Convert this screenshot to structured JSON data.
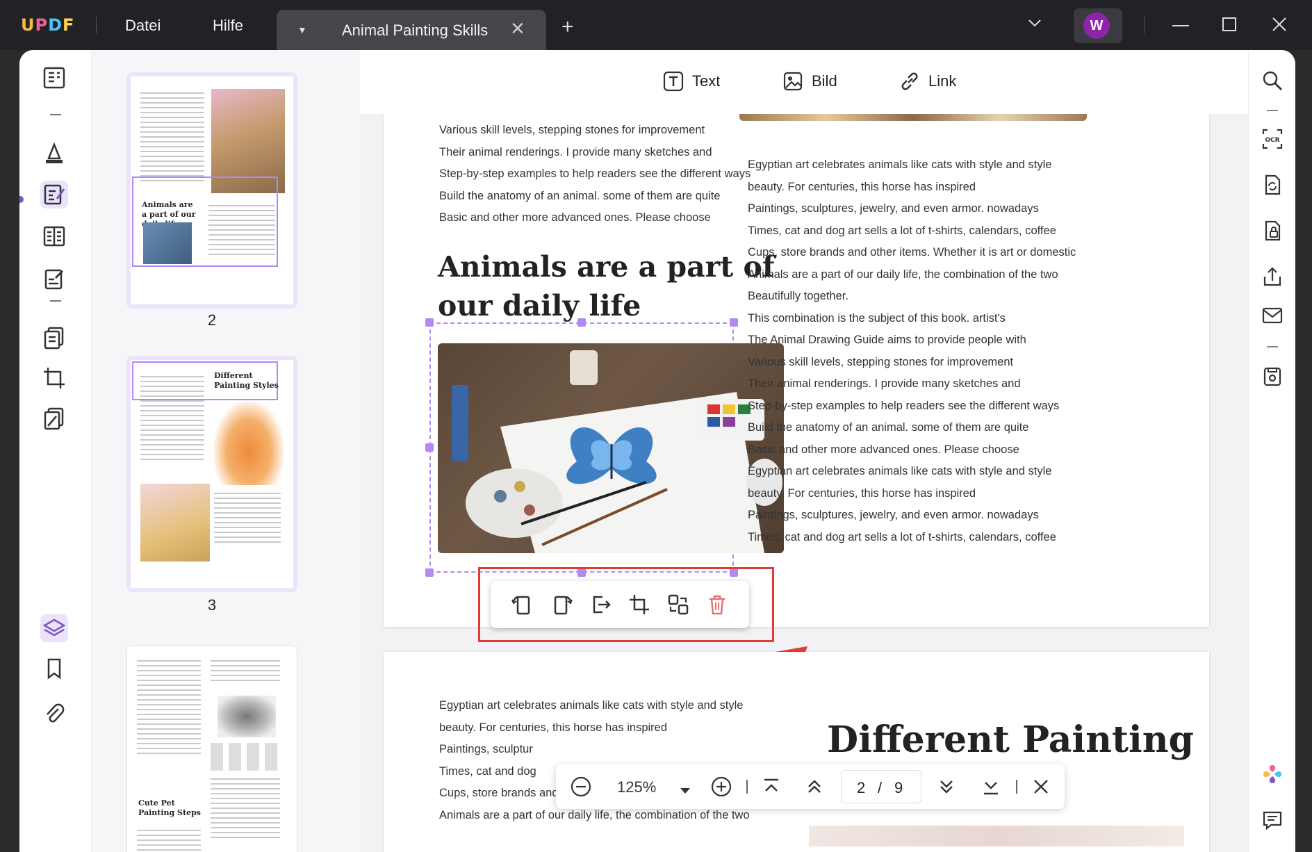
{
  "app": {
    "logo": "UPDF",
    "menu": [
      "Datei",
      "Hilfe"
    ],
    "tab_title": "Animal Painting Skills",
    "avatar_initial": "W"
  },
  "edit_toolbar": {
    "text_label": "Text",
    "image_label": "Bild",
    "link_label": "Link"
  },
  "thumbnails": [
    {
      "page_number": "2",
      "heading": "Animals are a part of our daily life"
    },
    {
      "page_number": "3",
      "heading": "Different Painting Styles"
    },
    {
      "page_number": "",
      "heading": "Cute Pet Painting Steps"
    }
  ],
  "page2": {
    "left_lines": [
      "Various skill levels, stepping stones for improvement",
      "Their animal renderings. I provide many sketches and",
      "Step-by-step examples to help readers see the different ways",
      "Build the anatomy of an animal. some of them are quite",
      "Basic and other more advanced ones. Please choose"
    ],
    "heading_line1": "Animals are a part of",
    "heading_line2": "our daily life",
    "right_lines": [
      "Egyptian art celebrates animals like cats with style and style",
      "beauty. For centuries, this horse has inspired",
      "Paintings, sculptures, jewelry, and even armor. nowadays",
      "Times, cat and dog art sells a lot of t-shirts, calendars, coffee",
      "Cups, store brands and other items. Whether it is art or domestic",
      "Animals are a part of our daily life, the combination of the two",
      "Beautifully together.",
      "This combination is the subject of this book. artist's",
      "The Animal Drawing Guide aims to provide people with",
      "Various skill levels, stepping stones for improvement",
      "Their animal renderings. I provide many sketches and",
      "Step-by-step examples to help readers see the different ways",
      "Build the anatomy of an animal. some of them are quite",
      "Basic and other more advanced ones. Please choose",
      "Egyptian art celebrates animals like cats with style and style",
      "beauty. For centuries, this horse has inspired",
      "Paintings, sculptures, jewelry, and even armor. nowadays",
      "Times, cat and dog art sells a lot of t-shirts, calendars, coffee"
    ]
  },
  "page3": {
    "left_lines": [
      "Egyptian art celebrates animals like cats with style and style",
      "beauty. For centuries, this horse has inspired",
      "Paintings, sculptur",
      "Times, cat and dog",
      "Cups, store brands and other items. Whether it is art or domestic",
      "Animals are a part of our daily life, the combination of the two"
    ],
    "heading": "Different Painting"
  },
  "navbar": {
    "zoom": "125%",
    "current_page": "2",
    "separator": "/",
    "total_pages": "9"
  },
  "colors": {
    "accent": "#b488f3",
    "highlight_red": "#e53935",
    "delete_red": "#e57373",
    "titlebar": "#222226"
  }
}
